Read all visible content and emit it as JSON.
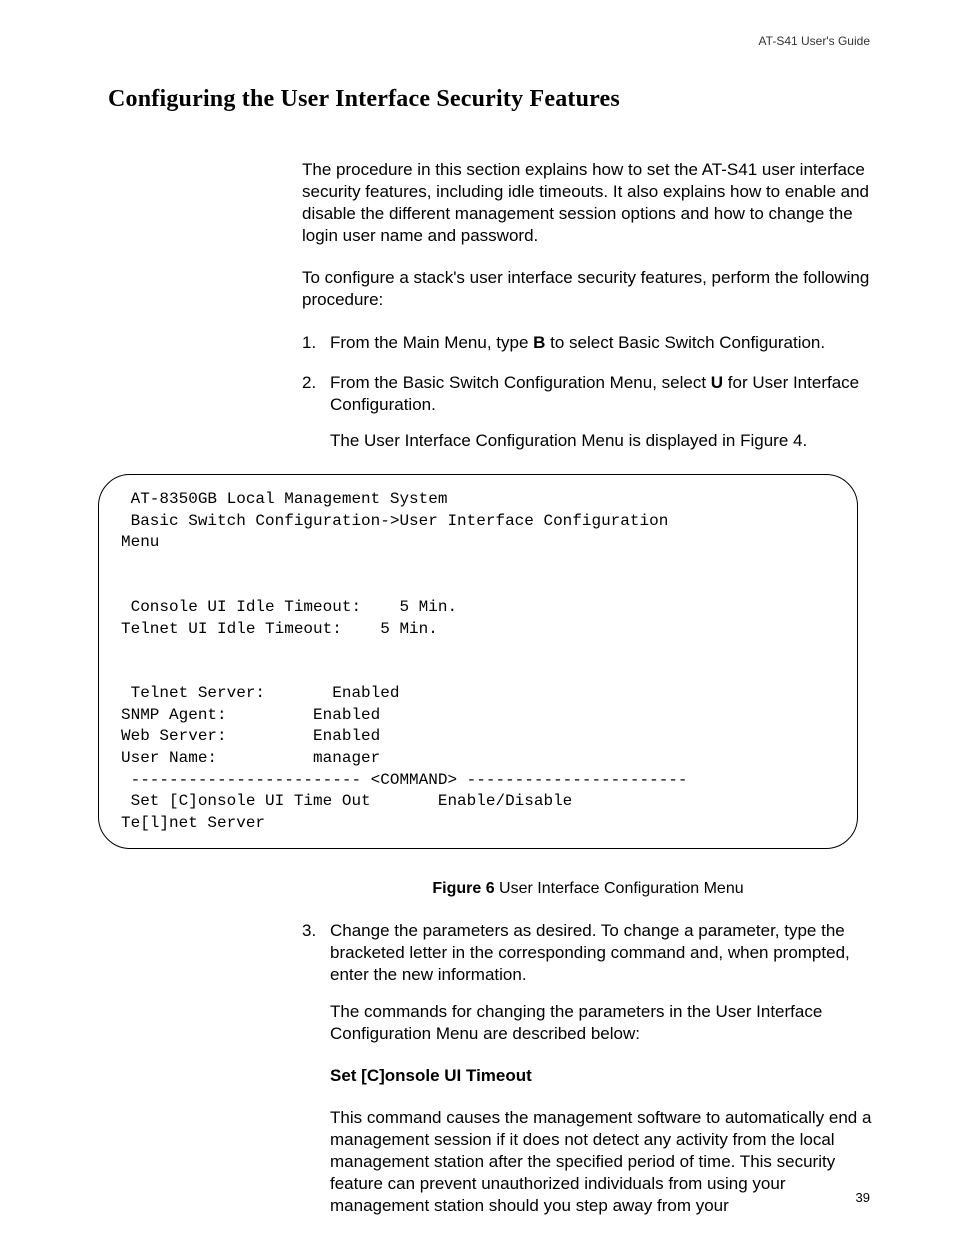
{
  "header": {
    "guide": "AT-S41 User's Guide"
  },
  "title": "Configuring the User Interface Security Features",
  "intro": {
    "p1": "The procedure in this section explains how to set the AT-S41 user interface security features, including idle timeouts. It also explains how to enable and disable the different management session options and how to change the login user name and password.",
    "p2": "To configure a stack's user interface security features, perform the following procedure:"
  },
  "steps": {
    "s1_pre": "From the Main Menu, type ",
    "s1_bold": "B",
    "s1_post": " to select Basic Switch Configuration.",
    "s2_pre": "From the Basic Switch Configuration Menu, select ",
    "s2_bold": "U",
    "s2_post": " for User Interface Configuration.",
    "s2_sub": "The User Interface Configuration Menu is displayed in Figure 4.",
    "s3_main": "Change the parameters as desired. To change a parameter, type the bracketed letter in the corresponding command and, when prompted, enter the new information.",
    "s3_sub": "The commands for changing the parameters in the User Interface Configuration Menu are described below:"
  },
  "figure": {
    "text": " AT-8350GB Local Management System\n Basic Switch Configuration->User Interface Configuration \nMenu\n\n\n Console UI Idle Timeout:    5 Min.\nTelnet UI Idle Timeout:    5 Min.\n\n\n Telnet Server:       Enabled\nSNMP Agent:         Enabled\nWeb Server:         Enabled\nUser Name:          manager\n ------------------------ <COMMAND> -----------------------\n Set [C]onsole UI Time Out       Enable/Disable \nTe[l]net Server",
    "caption_label": "Figure 6",
    "caption_text": "  User Interface Configuration Menu"
  },
  "cmd": {
    "heading": "Set [C]onsole UI Timeout",
    "body": "This command causes the management software to automatically end a management session if it does not detect any activity from the local management station after the specified period of time. This security feature can prevent unauthorized individuals from using your management station should you step away from your"
  },
  "page_number": "39"
}
